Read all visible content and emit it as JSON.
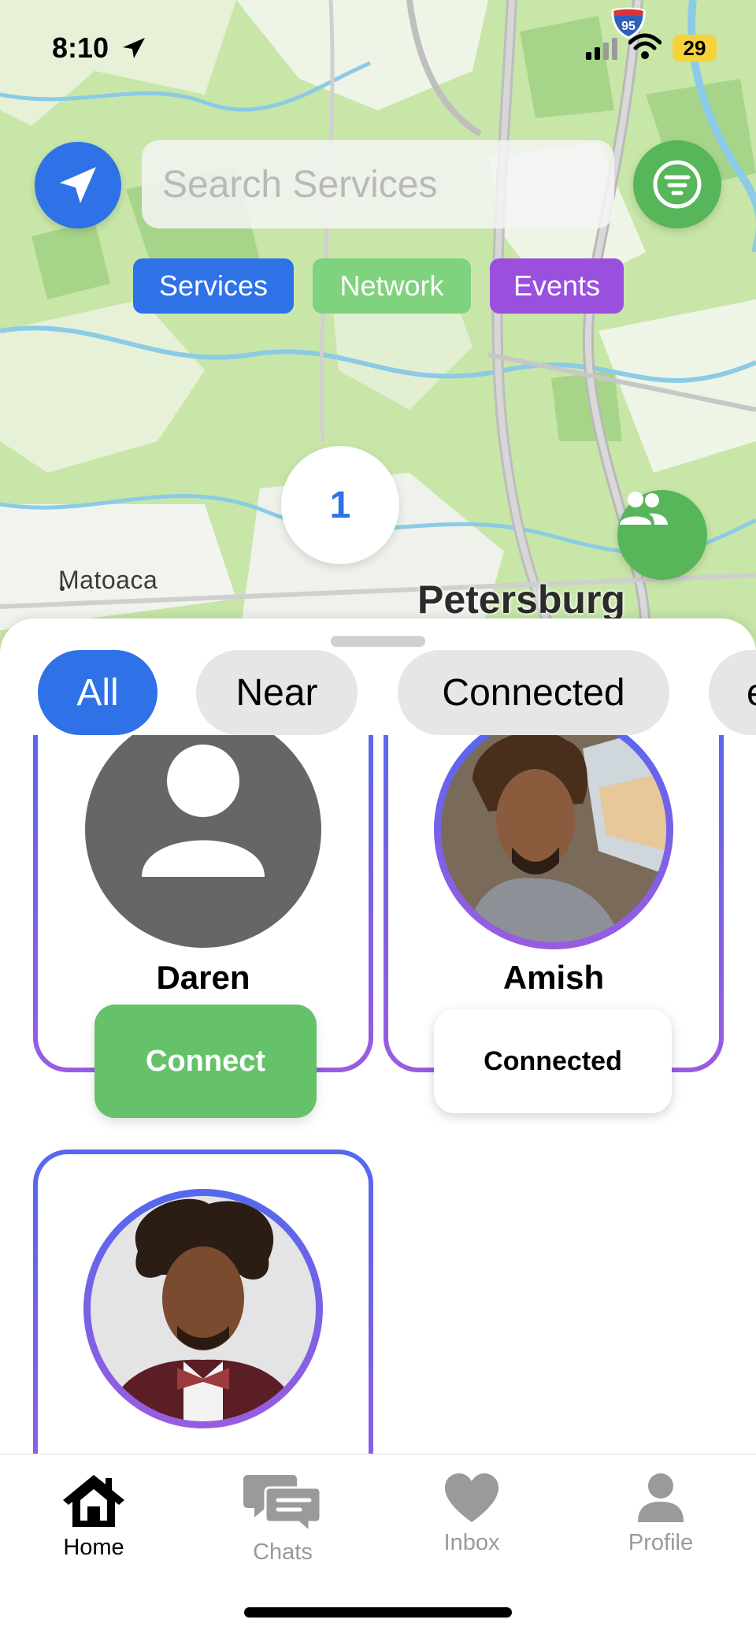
{
  "status_bar": {
    "time": "8:10",
    "battery": "29",
    "shield": "95"
  },
  "map": {
    "places": {
      "small": "Matoaca",
      "big": "Petersburg"
    },
    "cluster_count": "1"
  },
  "search": {
    "placeholder": "Search Services"
  },
  "chips": {
    "services": "Services",
    "network": "Network",
    "events": "Events"
  },
  "segments": {
    "all": "All",
    "near": "Near",
    "connected": "Connected",
    "more": "e"
  },
  "cards": [
    {
      "name": "Daren",
      "action": "Connect"
    },
    {
      "name": "Amish",
      "action": "Connected"
    },
    {
      "name": ""
    }
  ],
  "tabs": {
    "home": "Home",
    "chats": "Chats",
    "inbox": "Inbox",
    "profile": "Profile"
  },
  "colors": {
    "blue": "#2f71e6",
    "green": "#58b65a",
    "purple": "#9a4fde",
    "connect_green": "#66c26a"
  }
}
